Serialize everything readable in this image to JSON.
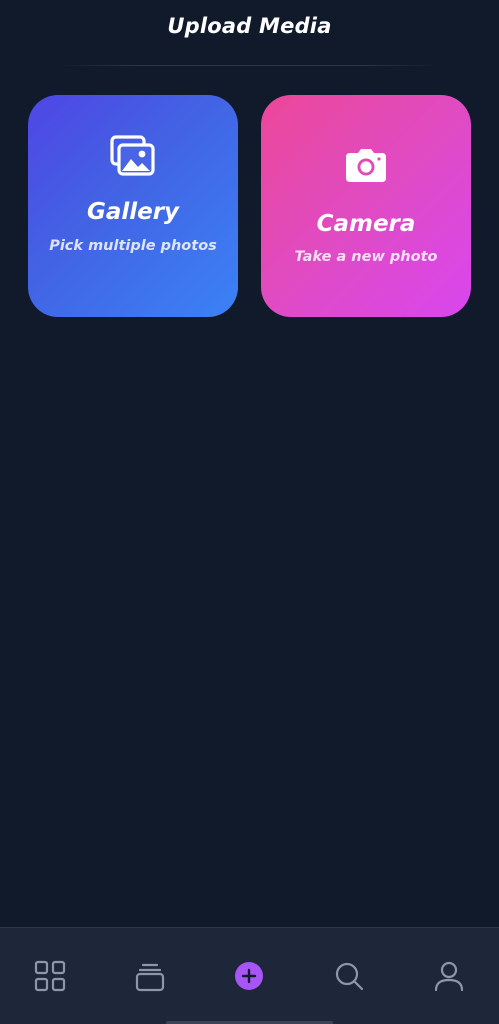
{
  "header": {
    "title": "Upload Media"
  },
  "cards": [
    {
      "id": "gallery",
      "icon": "images-icon",
      "title": "Gallery",
      "subtitle": "Pick multiple photos",
      "gradient": [
        "#4f46e5",
        "#3b82f6"
      ]
    },
    {
      "id": "camera",
      "icon": "camera-icon",
      "title": "Camera",
      "subtitle": "Take a new photo",
      "gradient": [
        "#ec4899",
        "#d946ef"
      ]
    }
  ],
  "bottom_nav": {
    "items": [
      {
        "icon": "grid-icon",
        "active": false
      },
      {
        "icon": "collection-icon",
        "active": false
      },
      {
        "icon": "add-icon",
        "active": true
      },
      {
        "icon": "search-icon",
        "active": false
      },
      {
        "icon": "user-icon",
        "active": false
      }
    ]
  },
  "colors": {
    "background": "#111a2b",
    "nav_background": "#1d2739",
    "nav_icon": "#8e97a8",
    "accent": "#a855f7"
  }
}
